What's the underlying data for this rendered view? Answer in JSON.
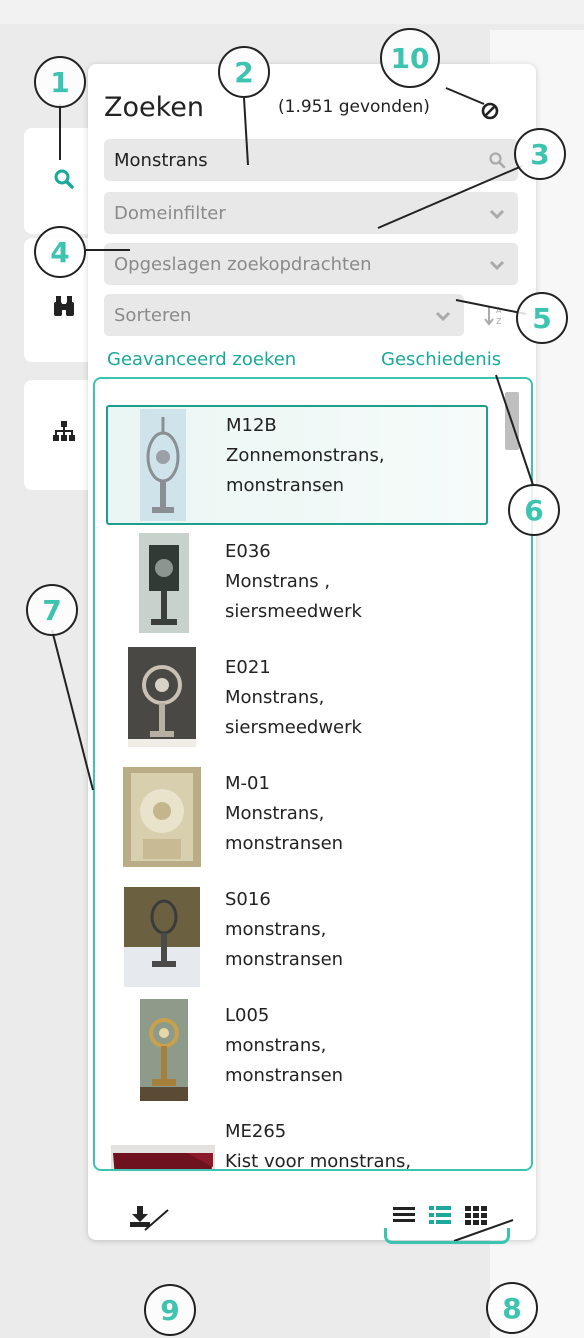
{
  "search": {
    "title": "Zoeken",
    "count": "(1.951 gevonden)",
    "query": "Monstrans",
    "domain_placeholder": "Domeinfilter",
    "saved_placeholder": "Opgeslagen zoekopdrachten",
    "sort_placeholder": "Sorteren",
    "advanced_link": "Geavanceerd zoeken",
    "history_link": "Geschiedenis"
  },
  "results": [
    {
      "id": "M12B",
      "line1": "Zonnemonstrans,",
      "line2": "monstransen"
    },
    {
      "id": "E036",
      "line1": "Monstrans ,",
      "line2": "siersmeedwerk"
    },
    {
      "id": "E021",
      "line1": "Monstrans,",
      "line2": "siersmeedwerk"
    },
    {
      "id": "M-01",
      "line1": "Monstrans,",
      "line2": "monstransen"
    },
    {
      "id": "S016",
      "line1": "monstrans,",
      "line2": "monstransen"
    },
    {
      "id": "L005",
      "line1": "monstrans,",
      "line2": "monstransen"
    },
    {
      "id": "ME265",
      "line1": "Kist voor monstrans,",
      "line2": ""
    }
  ],
  "annotations": [
    "1",
    "2",
    "3",
    "4",
    "5",
    "6",
    "7",
    "8",
    "9",
    "10"
  ],
  "icons": {
    "tab_search": "search-icon",
    "tab_binoculars": "binoculars-icon",
    "tab_tree": "sitemap-icon",
    "clear": "ban-icon",
    "search_field": "search-icon",
    "sort": "sort-alpha-icon",
    "download": "download-icon",
    "views": [
      "list-icon",
      "list-detail-icon",
      "grid-icon"
    ]
  },
  "colors": {
    "accent": "#3cc4b0",
    "link": "#1aa99a",
    "field_bg": "#e8e8e8"
  }
}
